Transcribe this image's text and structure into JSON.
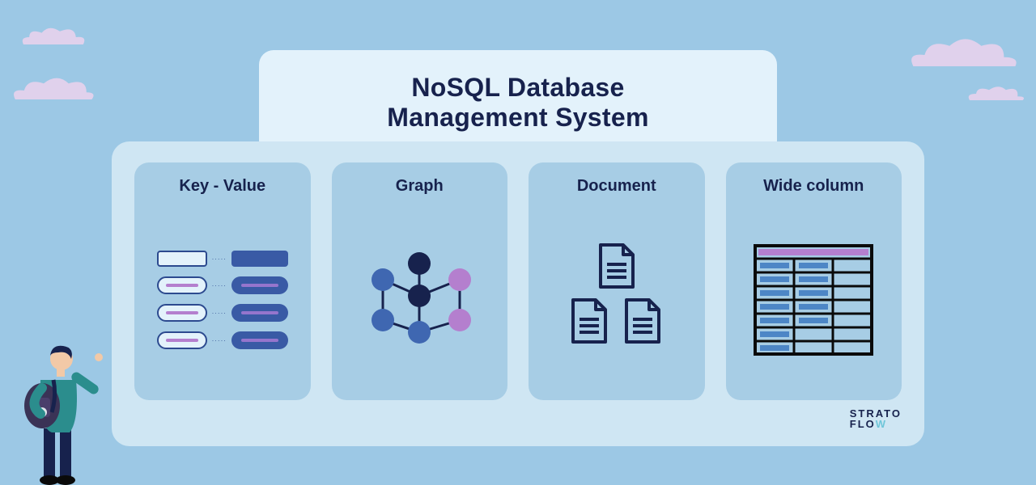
{
  "title": "NoSQL Database Management System",
  "cards": [
    {
      "title": "Key - Value"
    },
    {
      "title": "Graph"
    },
    {
      "title": "Document"
    },
    {
      "title": "Wide column"
    }
  ],
  "logo": {
    "line1": "STRATO",
    "line2_prefix": "FLO",
    "line2_accent": "W"
  }
}
